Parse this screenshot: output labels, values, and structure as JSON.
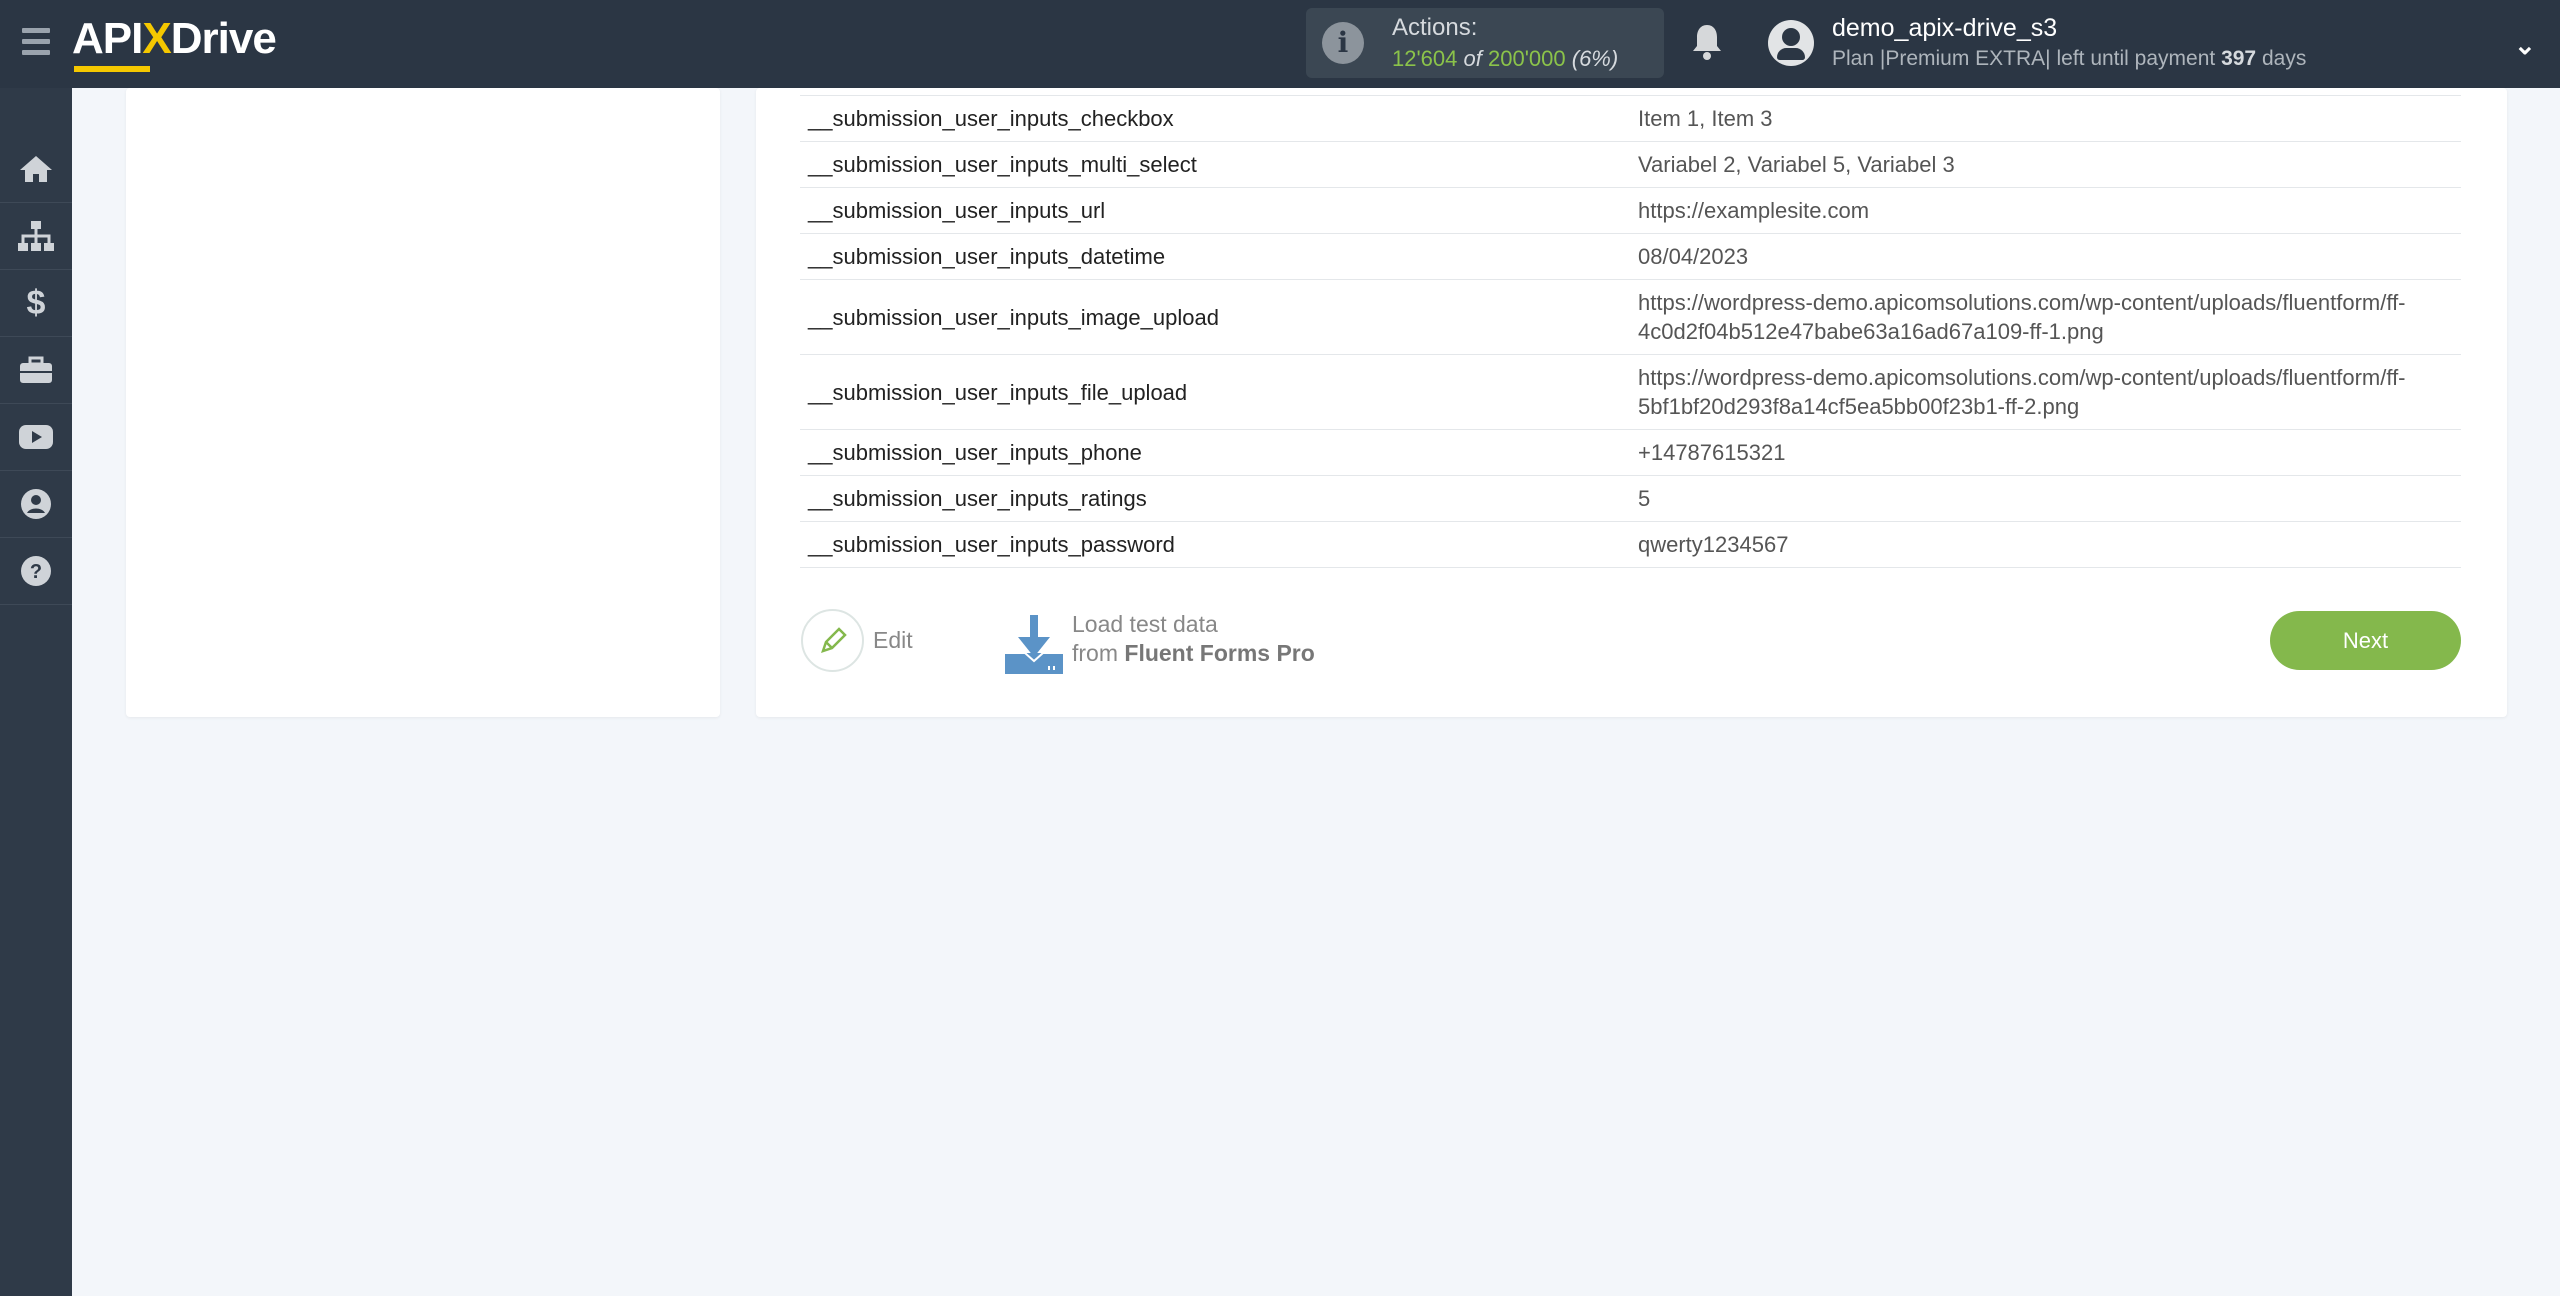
{
  "header": {
    "logo": "APIXDrive",
    "actions_label": "Actions:",
    "actions_used": "12'604",
    "actions_of": "of",
    "actions_total": "200'000",
    "actions_pct": "(6%)",
    "username": "demo_apix-drive_s3",
    "plan_prefix": "Plan |Premium EXTRA| left until payment",
    "plan_days": "397",
    "plan_suffix": "days"
  },
  "sidebar": {
    "items": [
      "home",
      "connections",
      "billing",
      "tools",
      "video",
      "account",
      "help"
    ]
  },
  "rows": [
    {
      "k": "__submission_user_inputs_checkbox",
      "v": "Item 1, Item 3"
    },
    {
      "k": "__submission_user_inputs_multi_select",
      "v": "Variabel 2, Variabel 5, Variabel 3"
    },
    {
      "k": "__submission_user_inputs_url",
      "v": "https://examplesite.com"
    },
    {
      "k": "__submission_user_inputs_datetime",
      "v": "08/04/2023"
    },
    {
      "k": "__submission_user_inputs_image_upload",
      "v": "https://wordpress-demo.apicomsolutions.com/wp-content/uploads/fluentform/ff-4c0d2f04b512e47babe63a16ad67a109-ff-1.png"
    },
    {
      "k": "__submission_user_inputs_file_upload",
      "v": "https://wordpress-demo.apicomsolutions.com/wp-content/uploads/fluentform/ff-5bf1bf20d293f8a14cf5ea5bb00f23b1-ff-2.png"
    },
    {
      "k": "__submission_user_inputs_phone",
      "v": "+14787615321"
    },
    {
      "k": "__submission_user_inputs_ratings",
      "v": "5"
    },
    {
      "k": "__submission_user_inputs_password",
      "v": "qwerty1234567"
    }
  ],
  "footer": {
    "edit": "Edit",
    "load_line1": "Load test data",
    "load_from": "from",
    "load_source": "Fluent Forms Pro",
    "next": "Next"
  },
  "colors": {
    "header": "#2b3644",
    "accent": "#84b84c",
    "logo_x": "#f5c800"
  }
}
